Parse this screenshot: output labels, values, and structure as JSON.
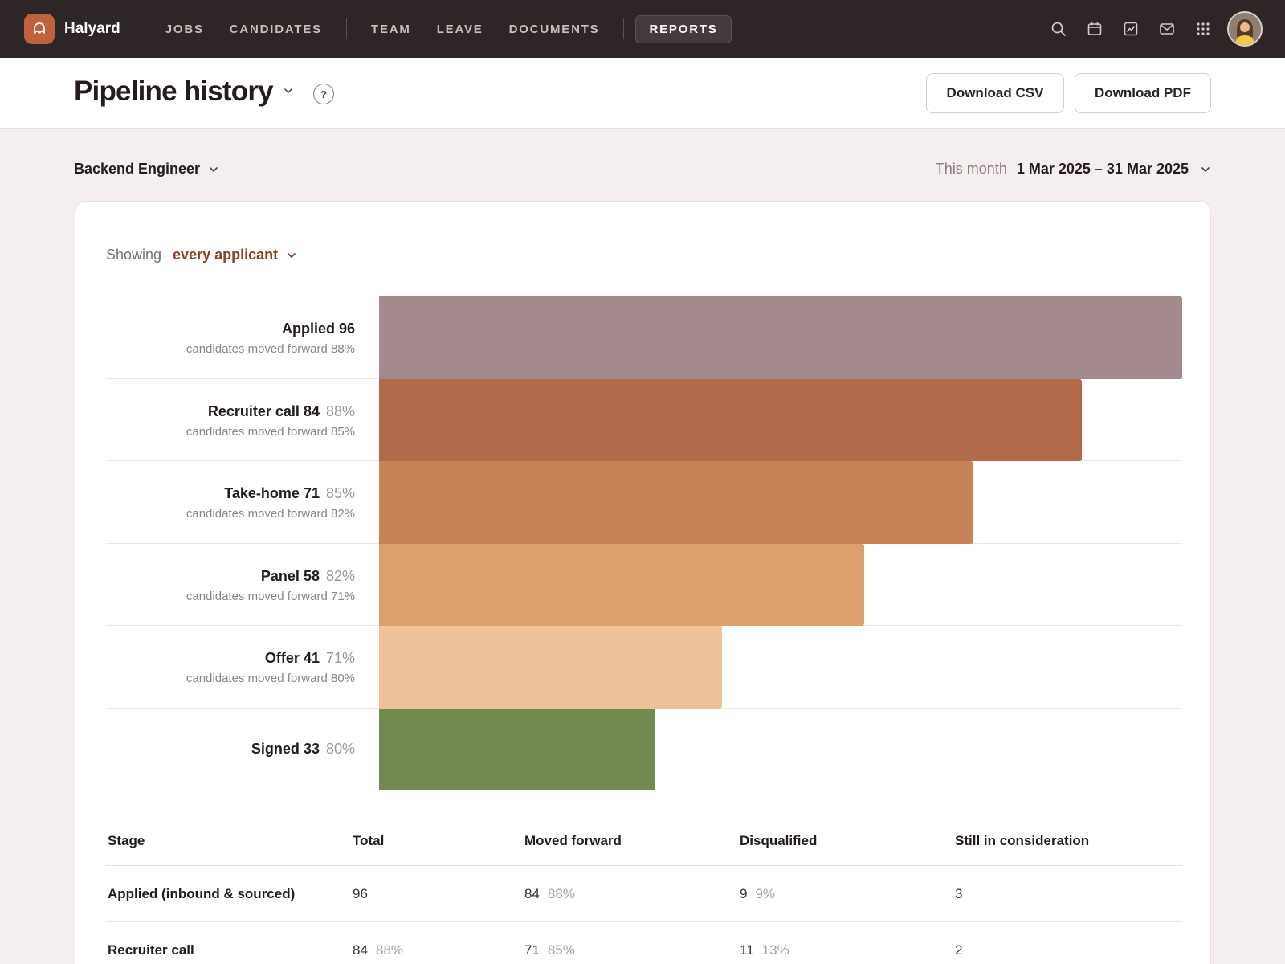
{
  "brand": {
    "name": "Halyard",
    "accent": "#c0613e"
  },
  "nav": {
    "groups": [
      [
        {
          "label": "JOBS"
        },
        {
          "label": "CANDIDATES"
        }
      ],
      [
        {
          "label": "TEAM"
        },
        {
          "label": "LEAVE"
        },
        {
          "label": "DOCUMENTS"
        }
      ],
      [
        {
          "label": "REPORTS",
          "active": true
        }
      ]
    ],
    "icons": [
      "search-icon",
      "calendar-icon",
      "analytics-icon",
      "mail-icon",
      "apps-grid-icon"
    ]
  },
  "header": {
    "title": "Pipeline history",
    "help": "?",
    "download_csv": "Download CSV",
    "download_pdf": "Download PDF"
  },
  "filters": {
    "role": "Backend Engineer",
    "date_label": "This month",
    "date_range": "1 Mar 2025 – 31 Mar 2025"
  },
  "showing": {
    "label": "Showing",
    "value": "every applicant"
  },
  "chart_data": {
    "type": "bar",
    "orientation": "horizontal-funnel",
    "categories": [
      "Applied",
      "Recruiter call",
      "Take-home",
      "Panel",
      "Offer",
      "Signed"
    ],
    "values": [
      96,
      84,
      71,
      58,
      41,
      33
    ],
    "conversion_from_previous": [
      "",
      "88%",
      "85%",
      "82%",
      "71%",
      "80%"
    ],
    "moved_forward_text": [
      "candidates moved forward 88%",
      "candidates moved forward 85%",
      "candidates moved forward 82%",
      "candidates moved forward 71%",
      "candidates moved forward 80%",
      ""
    ],
    "colors": [
      "#a48a8c",
      "#b16a4b",
      "#c78258",
      "#dca06d",
      "#efc399",
      "#728a4f"
    ],
    "xlim": [
      0,
      96
    ]
  },
  "table": {
    "headers": [
      "Stage",
      "Total",
      "Moved forward",
      "Disqualified",
      "Still in consideration"
    ],
    "rows": [
      {
        "stage": "Applied (inbound & sourced)",
        "total": "96",
        "total_pct": "",
        "moved": "84",
        "moved_pct": "88%",
        "dq": "9",
        "dq_pct": "9%",
        "still": "3"
      },
      {
        "stage": "Recruiter call",
        "total": "84",
        "total_pct": "88%",
        "moved": "71",
        "moved_pct": "85%",
        "dq": "11",
        "dq_pct": "13%",
        "still": "2"
      }
    ]
  }
}
